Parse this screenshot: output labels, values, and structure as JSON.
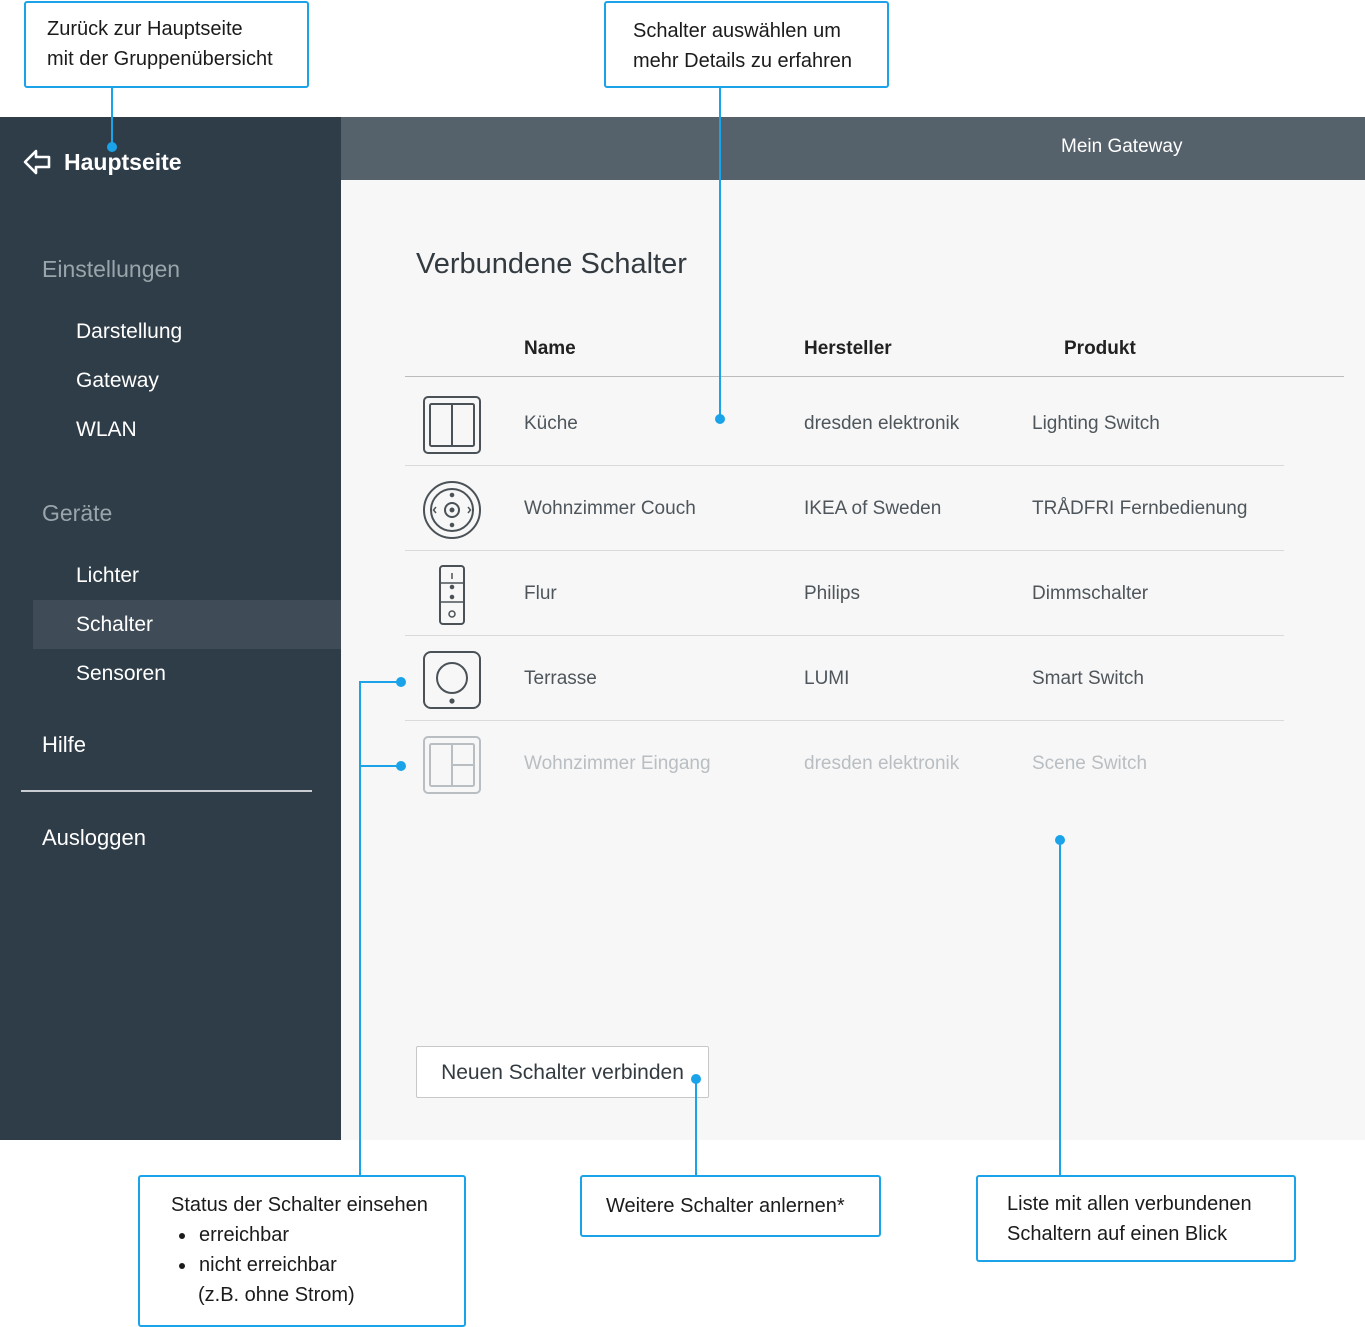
{
  "callouts": {
    "back": {
      "lines": [
        "Zurück zur Hauptseite",
        "mit der Gruppenübersicht"
      ]
    },
    "select": {
      "lines": [
        "Schalter auswählen um",
        "mehr Details zu erfahren"
      ]
    },
    "status": {
      "title": "Status der Schalter einsehen",
      "items": [
        "erreichbar",
        "nicht erreichbar"
      ],
      "note": "(z.B. ohne Strom)"
    },
    "learn": {
      "text": "Weitere Schalter anlernen*"
    },
    "list": {
      "lines": [
        "Liste mit allen verbundenen",
        "Schaltern auf einen Blick"
      ]
    }
  },
  "sidebar": {
    "back_label": "Hauptseite",
    "sections": [
      {
        "title": "Einstellungen",
        "items": [
          "Darstellung",
          "Gateway",
          "WLAN"
        ]
      },
      {
        "title": "Geräte",
        "items": [
          "Lichter",
          "Schalter",
          "Sensoren"
        ]
      }
    ],
    "active_item": "Schalter",
    "help": "Hilfe",
    "logout": "Ausloggen"
  },
  "header": {
    "title": "Mein Gateway"
  },
  "main": {
    "title": "Verbundene Schalter",
    "columns": [
      "Name",
      "Hersteller",
      "Produkt"
    ],
    "rows": [
      {
        "icon": "double-rocker-switch-icon",
        "name": "Küche",
        "manufacturer": "dresden elektronik",
        "product": "Lighting Switch",
        "reachable": true
      },
      {
        "icon": "round-remote-icon",
        "name": "Wohnzimmer Couch",
        "manufacturer": "IKEA of Sweden",
        "product": "TRÅDFRI Fernbedienung",
        "reachable": true
      },
      {
        "icon": "dimmer-remote-icon",
        "name": "Flur",
        "manufacturer": "Philips",
        "product": "Dimmschalter",
        "reachable": true
      },
      {
        "icon": "round-button-switch-icon",
        "name": "Terrasse",
        "manufacturer": "LUMI",
        "product": "Smart Switch",
        "reachable": true
      },
      {
        "icon": "scene-switch-icon",
        "name": "Wohnzimmer Eingang",
        "manufacturer": "dresden elektronik",
        "product": "Scene Switch",
        "reachable": false
      }
    ],
    "connect_button": "Neuen Schalter verbinden"
  },
  "colors": {
    "accent": "#1aa3e8",
    "sidebar": "#2f3d48",
    "topbar": "#56626b",
    "main_bg": "#f7f7f7"
  }
}
